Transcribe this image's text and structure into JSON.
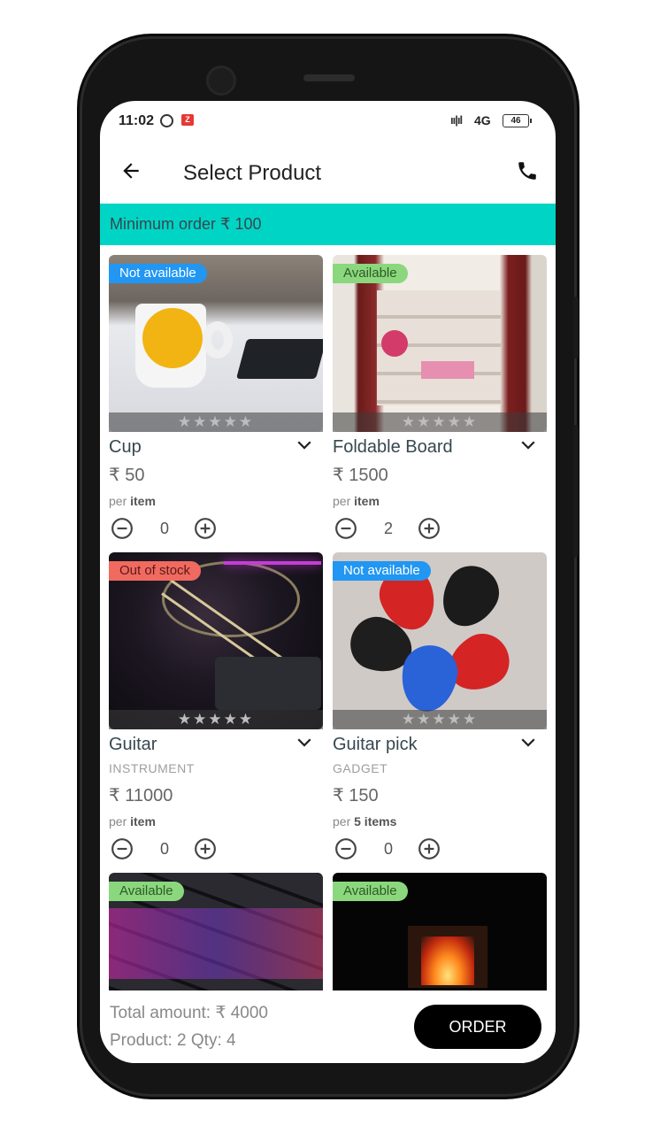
{
  "status_bar": {
    "time": "11:02",
    "signal": "ıı|ıl",
    "network": "4G",
    "battery": "46"
  },
  "app_bar": {
    "title": "Select Product"
  },
  "banner": {
    "text": "Minimum order ₹ 100"
  },
  "products": [
    {
      "name": "Cup",
      "category": "",
      "price": "₹ 50",
      "unit_prefix": "per",
      "unit": "item",
      "qty": "0",
      "status": "Not available",
      "rating": "★★★★★"
    },
    {
      "name": "Foldable Board",
      "category": "",
      "price": "₹ 1500",
      "unit_prefix": "per",
      "unit": "item",
      "qty": "2",
      "status": "Available",
      "rating": "★★★★★"
    },
    {
      "name": "Guitar",
      "category": "INSTRUMENT",
      "price": "₹ 11000",
      "unit_prefix": "per",
      "unit": "item",
      "qty": "0",
      "status": "Out of stock",
      "rating": "★★★★★"
    },
    {
      "name": "Guitar pick",
      "category": "GADGET",
      "price": "₹ 150",
      "unit_prefix": "per",
      "unit": "5 items",
      "qty": "0",
      "status": "Not available",
      "rating": "★★★★★"
    },
    {
      "name": "",
      "category": "",
      "price": "",
      "unit_prefix": "",
      "unit": "",
      "qty": "",
      "status": "Available",
      "rating": ""
    },
    {
      "name": "",
      "category": "",
      "price": "",
      "unit_prefix": "",
      "unit": "",
      "qty": "",
      "status": "Available",
      "rating": ""
    }
  ],
  "footer": {
    "total": "Total amount: ₹ 4000",
    "summary": "Product: 2  Qty: 4",
    "order_label": "ORDER"
  },
  "colors": {
    "accent": "#00d5c5",
    "available": "#8bd77d",
    "not_available": "#2196f3",
    "out_of_stock": "#f06a60"
  }
}
